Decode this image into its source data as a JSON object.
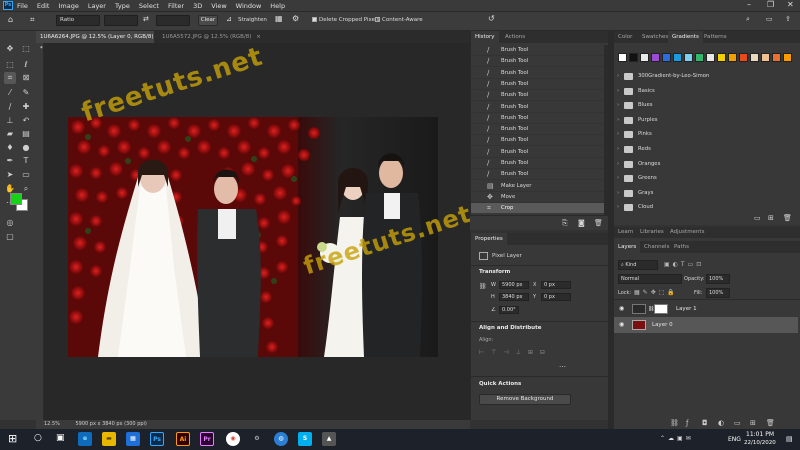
{
  "app": {
    "logo": "Ps",
    "menu": [
      "File",
      "Edit",
      "Image",
      "Layer",
      "Type",
      "Select",
      "Filter",
      "3D",
      "View",
      "Window",
      "Help"
    ],
    "window_controls": [
      "–",
      "❐",
      "✕"
    ]
  },
  "options_bar": {
    "ratio_value": "Ratio",
    "clear_label": "Clear",
    "straighten_label": "Straighten",
    "delete_cropped_label": "Delete Cropped Pixels",
    "content_aware_label": "Content-Aware"
  },
  "doc_tabs": [
    {
      "label": "1U6A6264.JPG @ 12.5% (Layer 0, RGB/8) *",
      "close": "×"
    },
    {
      "label": "1U6A5572.JPG @ 12.5% (RGB/8)",
      "close": "×"
    }
  ],
  "status": {
    "zoom": "12.5%",
    "info": "5900 px x 3840 px (300 ppi)"
  },
  "history": {
    "tabs": [
      "History",
      "Actions"
    ],
    "items": [
      "Brush Tool",
      "Brush Tool",
      "Brush Tool",
      "Brush Tool",
      "Brush Tool",
      "Brush Tool",
      "Brush Tool",
      "Brush Tool",
      "Brush Tool",
      "Brush Tool",
      "Brush Tool",
      "Brush Tool",
      "Make Layer",
      "Move",
      "Crop"
    ]
  },
  "properties": {
    "tab": "Properties",
    "kind": "Pixel Layer",
    "transform_head": "Transform",
    "w": "5900 px",
    "h": "3840 px",
    "x": "0 px",
    "y": "0 px",
    "angle": "0.00°",
    "align_head": "Align and Distribute",
    "align_label": "Align:",
    "quick_head": "Quick Actions",
    "remove_bg": "Remove Background"
  },
  "gradients": {
    "tabs": [
      "Color",
      "Swatches",
      "Gradients",
      "Patterns"
    ],
    "groups": [
      "300Gradient-by-Leo-Simon",
      "Basics",
      "Blues",
      "Purples",
      "Pinks",
      "Reds",
      "Oranges",
      "Greens",
      "Grays",
      "Cloud"
    ],
    "swatch_colors": [
      "#ffffff",
      "#111111",
      "#e9e9e9",
      "#9c4bd6",
      "#2b6de0",
      "#1a9be0",
      "#7ed0f0",
      "#2fb86c",
      "#e8e8e8",
      "#f3d000",
      "#f0a000",
      "#e84a1a",
      "#e8d8c0",
      "#f0c090",
      "#e87030",
      "#ff9a00"
    ]
  },
  "layers": {
    "tabs_top": [
      "Learn",
      "Libraries",
      "Adjustments"
    ],
    "tabs": [
      "Layers",
      "Channels",
      "Paths"
    ],
    "kind": "Kind",
    "blend": "Normal",
    "opacity_label": "Opacity:",
    "opacity": "100%",
    "lock_label": "Lock:",
    "fill_label": "Fill:",
    "fill": "100%",
    "items": [
      "Layer 1",
      "Layer 0"
    ]
  },
  "taskbar": {
    "time": "11:01 PM",
    "date": "22/10/2020",
    "lang": "ENG",
    "apps": [
      "Ps",
      "Ai",
      "Pr"
    ]
  },
  "watermark": "freetuts.net",
  "colors": {
    "foreground": "#17d217",
    "background": "#ffffff",
    "accent": "#31a8ff"
  }
}
